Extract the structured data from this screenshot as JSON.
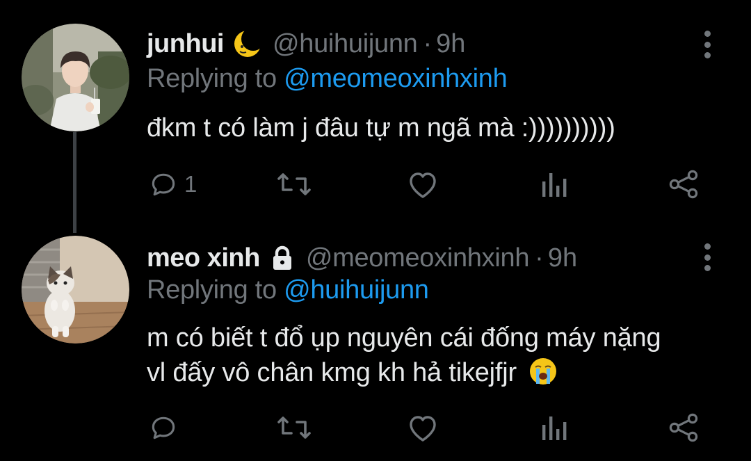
{
  "tweets": [
    {
      "name": "junhui",
      "name_emoji": "crescent-moon",
      "handle": "@huihuijunn",
      "separator": "·",
      "time": "9h",
      "replying_prefix": "Replying to",
      "replying_to": "@meomeoxinhxinh",
      "text_lines": [
        "đkm t có làm j đâu tự m ngã mà :))))))))))"
      ],
      "reply_count": "1"
    },
    {
      "name": "meo xinh",
      "name_icon": "lock-icon",
      "handle": "@meomeoxinhxinh",
      "separator": "·",
      "time": "9h",
      "replying_prefix": "Replying to",
      "replying_to": "@huihuijunn",
      "text_lines": [
        "m có biết t đổ ụp nguyên cái đống máy nặng",
        "vl đấy vô chân kmg kh hả tikejfjr"
      ],
      "text_emoji": "loudly-crying-face",
      "reply_count": ""
    }
  ],
  "colors": {
    "background": "#000000",
    "primary_text": "#e7e9ea",
    "secondary_text": "#71767b",
    "link": "#1d9bf0",
    "thread_line": "#3d4145"
  }
}
